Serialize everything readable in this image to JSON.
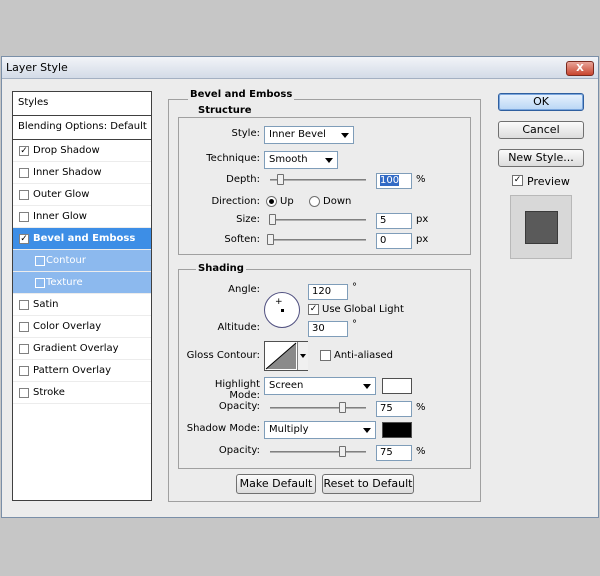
{
  "window": {
    "title": "Layer Style",
    "close": "X"
  },
  "left": {
    "styles_header": "Styles",
    "blending": "Blending Options: Default",
    "items": [
      {
        "label": "Drop Shadow",
        "checked": "✓"
      },
      {
        "label": "Inner Shadow",
        "checked": ""
      },
      {
        "label": "Outer Glow",
        "checked": ""
      },
      {
        "label": "Inner Glow",
        "checked": ""
      },
      {
        "label": "Bevel and Emboss",
        "checked": "✓"
      },
      {
        "label": "Contour",
        "checked": ""
      },
      {
        "label": "Texture",
        "checked": ""
      },
      {
        "label": "Satin",
        "checked": ""
      },
      {
        "label": "Color Overlay",
        "checked": ""
      },
      {
        "label": "Gradient Overlay",
        "checked": ""
      },
      {
        "label": "Pattern Overlay",
        "checked": ""
      },
      {
        "label": "Stroke",
        "checked": ""
      }
    ]
  },
  "bevel": {
    "title": "Bevel and Emboss",
    "structure": {
      "title": "Structure",
      "style_label": "Style:",
      "style_value": "Inner Bevel",
      "technique_label": "Technique:",
      "technique_value": "Smooth",
      "depth_label": "Depth:",
      "depth_value": "100",
      "depth_unit": "%",
      "depth_level": 0.1,
      "direction_label": "Direction:",
      "dir_up": "Up",
      "dir_down": "Down",
      "size_label": "Size:",
      "size_value": "5",
      "size_unit": "px",
      "size_level": 0.02,
      "soften_label": "Soften:",
      "soften_value": "0",
      "soften_unit": "px",
      "soften_level": 0
    },
    "shading": {
      "title": "Shading",
      "angle_label": "Angle:",
      "angle_value": "120",
      "angle_unit": "°",
      "global_light_label": "Use Global Light",
      "global_light_checked": "✓",
      "altitude_label": "Altitude:",
      "altitude_value": "30",
      "altitude_unit": "°",
      "gloss_label": "Gloss Contour:",
      "antialias_label": "Anti-aliased",
      "antialias_checked": "",
      "highlight_label": "Highlight Mode:",
      "highlight_mode": "Screen",
      "highlight_color": "#ffffff",
      "hopacity_label": "Opacity:",
      "hopacity_value": "75",
      "hopacity_unit": "%",
      "hopacity_level": 0.75,
      "shadow_label": "Shadow Mode:",
      "shadow_mode": "Multiply",
      "shadow_color": "#000000",
      "sopacity_label": "Opacity:",
      "sopacity_value": "75",
      "sopacity_unit": "%",
      "sopacity_level": 0.75
    },
    "make_default": "Make Default",
    "reset_default": "Reset to Default"
  },
  "right": {
    "ok": "OK",
    "cancel": "Cancel",
    "new_style": "New Style...",
    "preview_label": "Preview",
    "preview_checked": "✓"
  },
  "colors": {
    "accent": "#3d8ee6",
    "sub": "#8cb9ee"
  }
}
